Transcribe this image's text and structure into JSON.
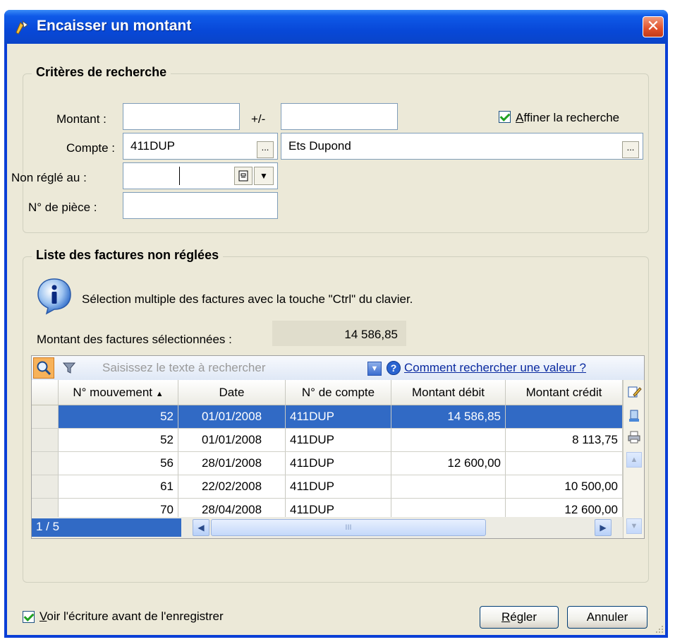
{
  "window": {
    "title": "Encaisser un montant"
  },
  "criteria": {
    "legend": "Critères de recherche",
    "montant_label": "Montant :",
    "plusminus_label": "+/-",
    "montant_value": "",
    "tolerance_value": "",
    "refine_label_accel": "A",
    "refine_label_rest": "ffiner la recherche",
    "refine_checked": true,
    "compte_label": "Compte :",
    "compte_value": "411DUP",
    "compte_name": "Ets Dupond",
    "browse_label": "...",
    "non_regle_label": "Non réglé au :",
    "non_regle_value": "",
    "piece_label": "N° de pièce :",
    "piece_value": ""
  },
  "invoices": {
    "legend": "Liste des factures non réglées",
    "info_text": "Sélection multiple des factures avec la touche \"Ctrl\" du clavier.",
    "selected_total_label": "Montant des factures sélectionnées :",
    "selected_total_value": "14 586,85",
    "search_placeholder": "Saisissez le texte à rechercher",
    "help_link": "Comment rechercher une valeur ?",
    "columns": [
      "N° mouvement",
      "Date",
      "N° de compte",
      "Montant débit",
      "Montant crédit"
    ],
    "rows": [
      {
        "mvt": "52",
        "date": "01/01/2008",
        "compte": "411DUP",
        "debit": "14 586,85",
        "credit": "",
        "selected": true
      },
      {
        "mvt": "52",
        "date": "01/01/2008",
        "compte": "411DUP",
        "debit": "",
        "credit": "8 113,75",
        "selected": false
      },
      {
        "mvt": "56",
        "date": "28/01/2008",
        "compte": "411DUP",
        "debit": "12 600,00",
        "credit": "",
        "selected": false
      },
      {
        "mvt": "61",
        "date": "22/02/2008",
        "compte": "411DUP",
        "debit": "",
        "credit": "10 500,00",
        "selected": false
      },
      {
        "mvt": "70",
        "date": "28/04/2008",
        "compte": "411DUP",
        "debit": "",
        "credit": "12 600,00",
        "selected": false
      }
    ],
    "pager": "1 / 5",
    "scroll_grip": "III"
  },
  "footer": {
    "preview_label_accel": "V",
    "preview_label_rest": "oir l'écriture avant de l'enregistrer",
    "preview_checked": true,
    "pay_label_accel": "R",
    "pay_label_rest": "égler",
    "cancel_label": "Annuler"
  },
  "colors": {
    "title_bar": "#0a44c8",
    "selection": "#316ac5",
    "dialog_bg": "#ece9d8",
    "link": "#0a2aa0"
  }
}
